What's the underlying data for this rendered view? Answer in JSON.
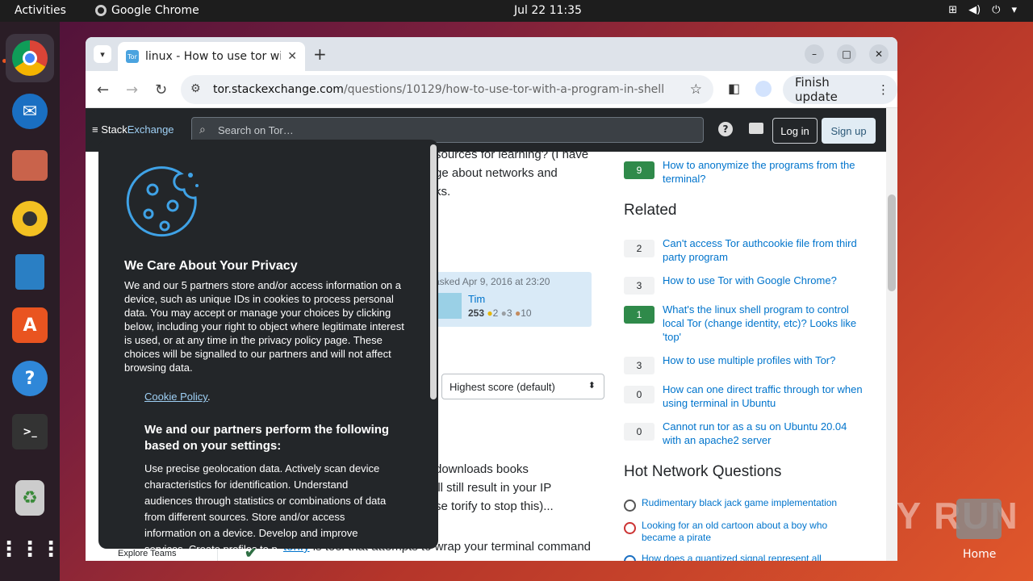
{
  "topbar": {
    "activities": "Activities",
    "app_name": "Google Chrome",
    "clock": "Jul 22  11:35"
  },
  "browser": {
    "tab_title": "linux - How to use tor wi",
    "url_host": "tor.stackexchange.com",
    "url_path": "/questions/10129/how-to-use-tor-with-a-program-in-shell",
    "finish_update": "Finish update"
  },
  "site": {
    "logo_a": "Stack",
    "logo_b": "Exchange",
    "search_placeholder": "Search on Tor…",
    "login": "Log in",
    "signup": "Sign up",
    "explore_teams": "Explore Teams"
  },
  "question": {
    "lines": [
      "sources for learning? (I have",
      "ge about networks and",
      "ks."
    ],
    "asked": "asked Apr 9, 2016 at 23:20",
    "user": "Tim",
    "rep": "253",
    "gold": "2",
    "silver": "3",
    "bronze": "10",
    "sort": "Highest score (default)",
    "answer_lines": [
      "downloads books",
      "ill still result in your IP",
      "se torify to stop this)...",
      "is tool that attempts to wrap your terminal command"
    ],
    "answer_link": "torify"
  },
  "sidebar": {
    "top_item": {
      "score": "9",
      "title": "How to anonymize the programs from the terminal?"
    },
    "related_title": "Related",
    "related": [
      {
        "score": "2",
        "title": "Can't access Tor authcookie file from third party program",
        "accepted": false
      },
      {
        "score": "3",
        "title": "How to use Tor with Google Chrome?",
        "accepted": false
      },
      {
        "score": "1",
        "title": "What's the linux shell program to control local Tor (change identity, etc)? Looks like 'top'",
        "accepted": true
      },
      {
        "score": "3",
        "title": "How to use multiple profiles with Tor?",
        "accepted": false
      },
      {
        "score": "0",
        "title": "How can one direct traffic through tor when using terminal in Ubuntu",
        "accepted": false
      },
      {
        "score": "0",
        "title": "Cannot run tor as a su on Ubuntu 20.04 with an apache2 server",
        "accepted": false
      }
    ],
    "hot_title": "Hot Network Questions",
    "hot": [
      "Rudimentary black jack game implementation",
      "Looking for an old cartoon about a boy who became a pirate",
      "How does a quantized signal represent all"
    ]
  },
  "cookie": {
    "title": "We Care About Your Privacy",
    "body": "We and our 5 partners store and/or access information on a device, such as unique IDs in cookies to process personal data. You may accept or manage your choices by clicking below, including your right to object where legitimate interest is used, or at any time in the privacy policy page. These choices will be signalled to our partners and will not affect browsing data.",
    "policy_link": "Cookie Policy",
    "policy_dot": ".",
    "partners_heading": "We and our partners perform the following based on your settings:",
    "purposes": "Use precise geolocation data. Actively scan device characteristics for identification. Understand audiences through statistics or combinations of data from different sources. Store and/or access information on a device. Develop and improve services. Create profiles to p"
  },
  "desktop": {
    "home_label": "Home",
    "watermark": "ANY RUN"
  },
  "colors": {
    "accent": "#e95420",
    "link": "#0074cc",
    "accepted": "#2f8a4a"
  }
}
